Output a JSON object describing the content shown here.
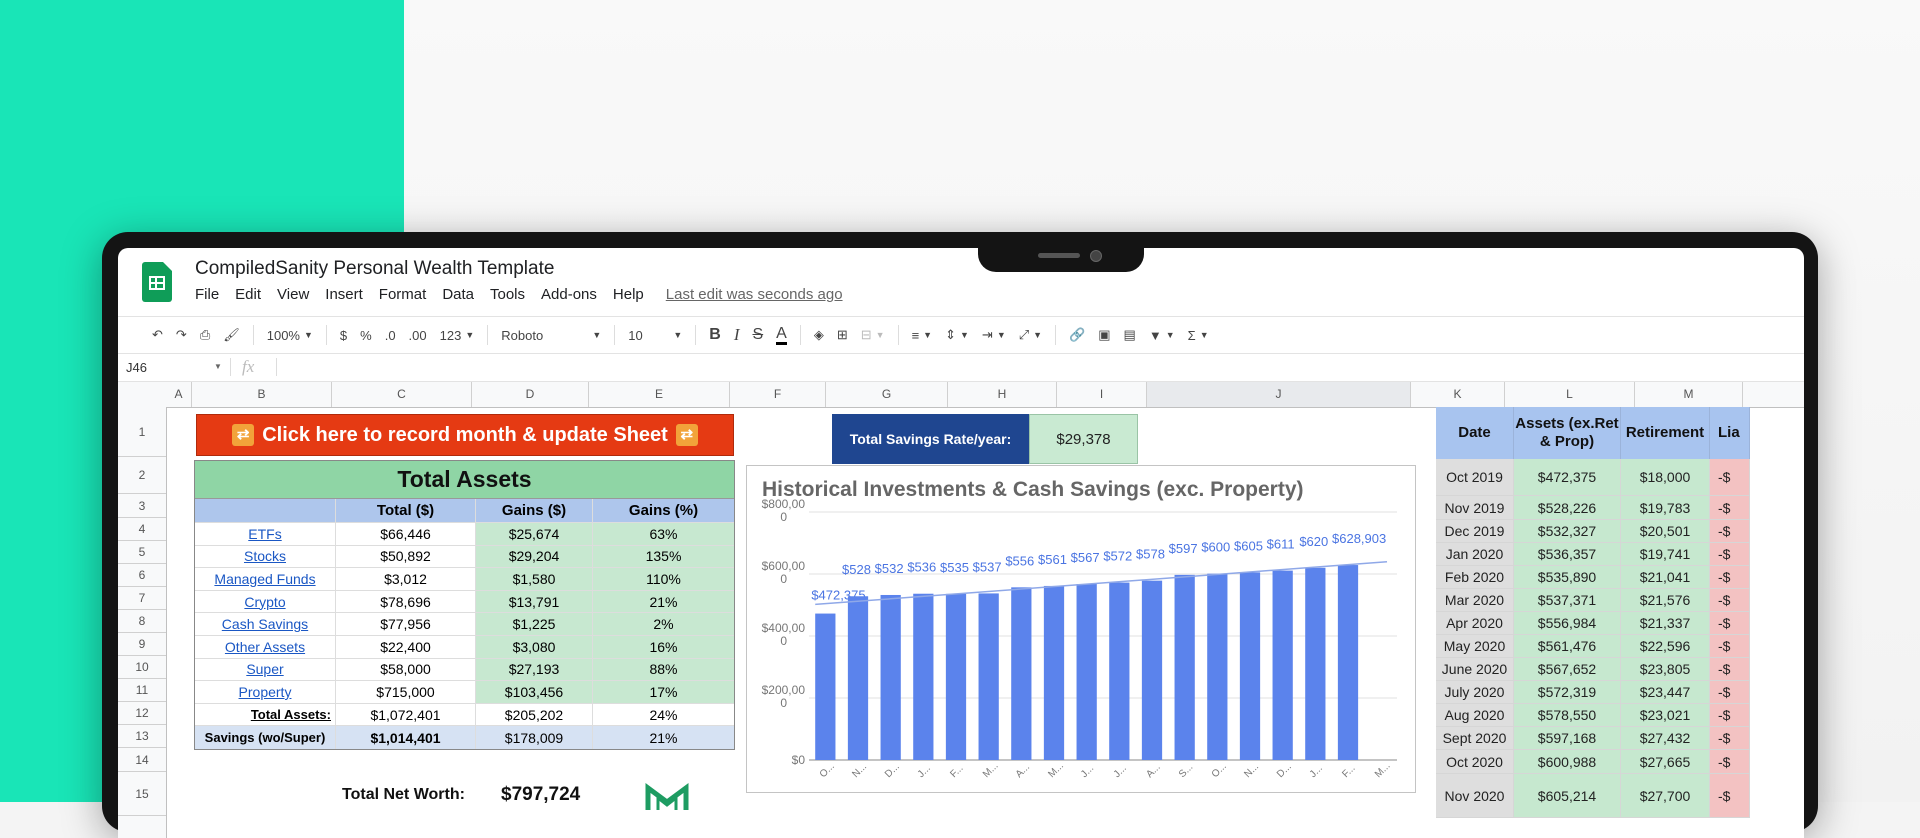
{
  "app": {
    "doc_title": "CompiledSanity Personal Wealth Template",
    "menu": [
      "File",
      "Edit",
      "View",
      "Insert",
      "Format",
      "Data",
      "Tools",
      "Add-ons",
      "Help"
    ],
    "last_edit": "Last edit was seconds ago"
  },
  "toolbar": {
    "zoom": "100%",
    "currency": "$",
    "percent": "%",
    "dec_less": ".0",
    "dec_more": ".00",
    "more_formats": "123",
    "font": "Roboto",
    "font_size": "10",
    "bold": "B",
    "italic": "I",
    "strike": "S",
    "text_color": "A"
  },
  "formula_bar": {
    "cell_ref": "J46",
    "fx": "fx"
  },
  "columns": [
    "A",
    "B",
    "C",
    "D",
    "E",
    "F",
    "G",
    "H",
    "I",
    "J",
    "K",
    "L",
    "M"
  ],
  "rows": [
    "1",
    "2",
    "3",
    "4",
    "5",
    "6",
    "7",
    "8",
    "9",
    "10",
    "11",
    "12",
    "13",
    "14",
    "15"
  ],
  "record_button": "Click here to record month & update Sheet",
  "savings_rate": {
    "label": "Total Savings Rate/year:",
    "value": "$29,378"
  },
  "assets": {
    "title": "Total Assets",
    "headers": [
      "",
      "Total ($)",
      "Gains ($)",
      "Gains (%)"
    ],
    "rows": [
      [
        "ETFs",
        "$66,446",
        "$25,674",
        "63%"
      ],
      [
        "Stocks",
        "$50,892",
        "$29,204",
        "135%"
      ],
      [
        "Managed Funds",
        "$3,012",
        "$1,580",
        "110%"
      ],
      [
        "Crypto",
        "$78,696",
        "$13,791",
        "21%"
      ],
      [
        "Cash Savings",
        "$77,956",
        "$1,225",
        "2%"
      ],
      [
        "Other Assets",
        "$22,400",
        "$3,080",
        "16%"
      ],
      [
        "Super",
        "$58,000",
        "$27,193",
        "88%"
      ],
      [
        "Property",
        "$715,000",
        "$103,456",
        "17%"
      ]
    ],
    "total": [
      "Total Assets:",
      "$1,072,401",
      "$205,202",
      "24%"
    ],
    "savings": [
      "Savings (wo/Super)",
      "$1,014,401",
      "$178,009",
      "21%"
    ]
  },
  "net_worth": {
    "label": "Total Net Worth:",
    "value": "$797,724"
  },
  "chart_data": {
    "type": "bar",
    "title": "Historical Investments & Cash Savings (exc. Property)",
    "y_ticks": [
      "$800,000",
      "$600,000",
      "$400,000",
      "$200,000",
      "$0"
    ],
    "ylim": [
      0,
      800000
    ],
    "categories": [
      "O...",
      "N...",
      "D...",
      "J...",
      "F...",
      "M...",
      "A...",
      "M...",
      "J...",
      "J...",
      "A...",
      "S...",
      "O...",
      "N...",
      "D...",
      "J...",
      "F...",
      "M..."
    ],
    "values": [
      472375,
      528226,
      532327,
      536357,
      535890,
      537371,
      556984,
      561476,
      567652,
      572319,
      578550,
      597168,
      600988,
      605214,
      611000,
      620000,
      628903,
      null
    ],
    "data_labels": [
      "$472,375",
      "$528",
      "$532",
      "$536",
      "$535",
      "$537",
      "$556",
      "$561",
      "$567",
      "$572",
      "$578",
      "$597",
      "$600",
      "$605",
      "$611",
      "$620",
      "$628,903",
      ""
    ],
    "trendline": true,
    "grid": true,
    "colors": {
      "bar": "#5b83ec",
      "label": "#4a74e2"
    }
  },
  "right_table": {
    "headers": [
      "Date",
      "Assets (ex.Ret & Prop)",
      "Retirement",
      "Lia"
    ],
    "rows": [
      [
        "Oct 2019",
        "$472,375",
        "$18,000",
        "-$"
      ],
      [
        "Nov 2019",
        "$528,226",
        "$19,783",
        "-$"
      ],
      [
        "Dec 2019",
        "$532,327",
        "$20,501",
        "-$"
      ],
      [
        "Jan 2020",
        "$536,357",
        "$19,741",
        "-$"
      ],
      [
        "Feb 2020",
        "$535,890",
        "$21,041",
        "-$"
      ],
      [
        "Mar 2020",
        "$537,371",
        "$21,576",
        "-$"
      ],
      [
        "Apr 2020",
        "$556,984",
        "$21,337",
        "-$"
      ],
      [
        "May 2020",
        "$561,476",
        "$22,596",
        "-$"
      ],
      [
        "June 2020",
        "$567,652",
        "$23,805",
        "-$"
      ],
      [
        "July 2020",
        "$572,319",
        "$23,447",
        "-$"
      ],
      [
        "Aug 2020",
        "$578,550",
        "$23,021",
        "-$"
      ],
      [
        "Sept 2020",
        "$597,168",
        "$27,432",
        "-$"
      ],
      [
        "Oct 2020",
        "$600,988",
        "$27,665",
        "-$"
      ],
      [
        "Nov 2020",
        "$605,214",
        "$27,700",
        "-$"
      ]
    ]
  },
  "colors": {
    "teal": "#19e5b7",
    "sheets_green": "#0f9d58",
    "button_red": "#e53a13",
    "rate_blue": "#1f4690"
  }
}
